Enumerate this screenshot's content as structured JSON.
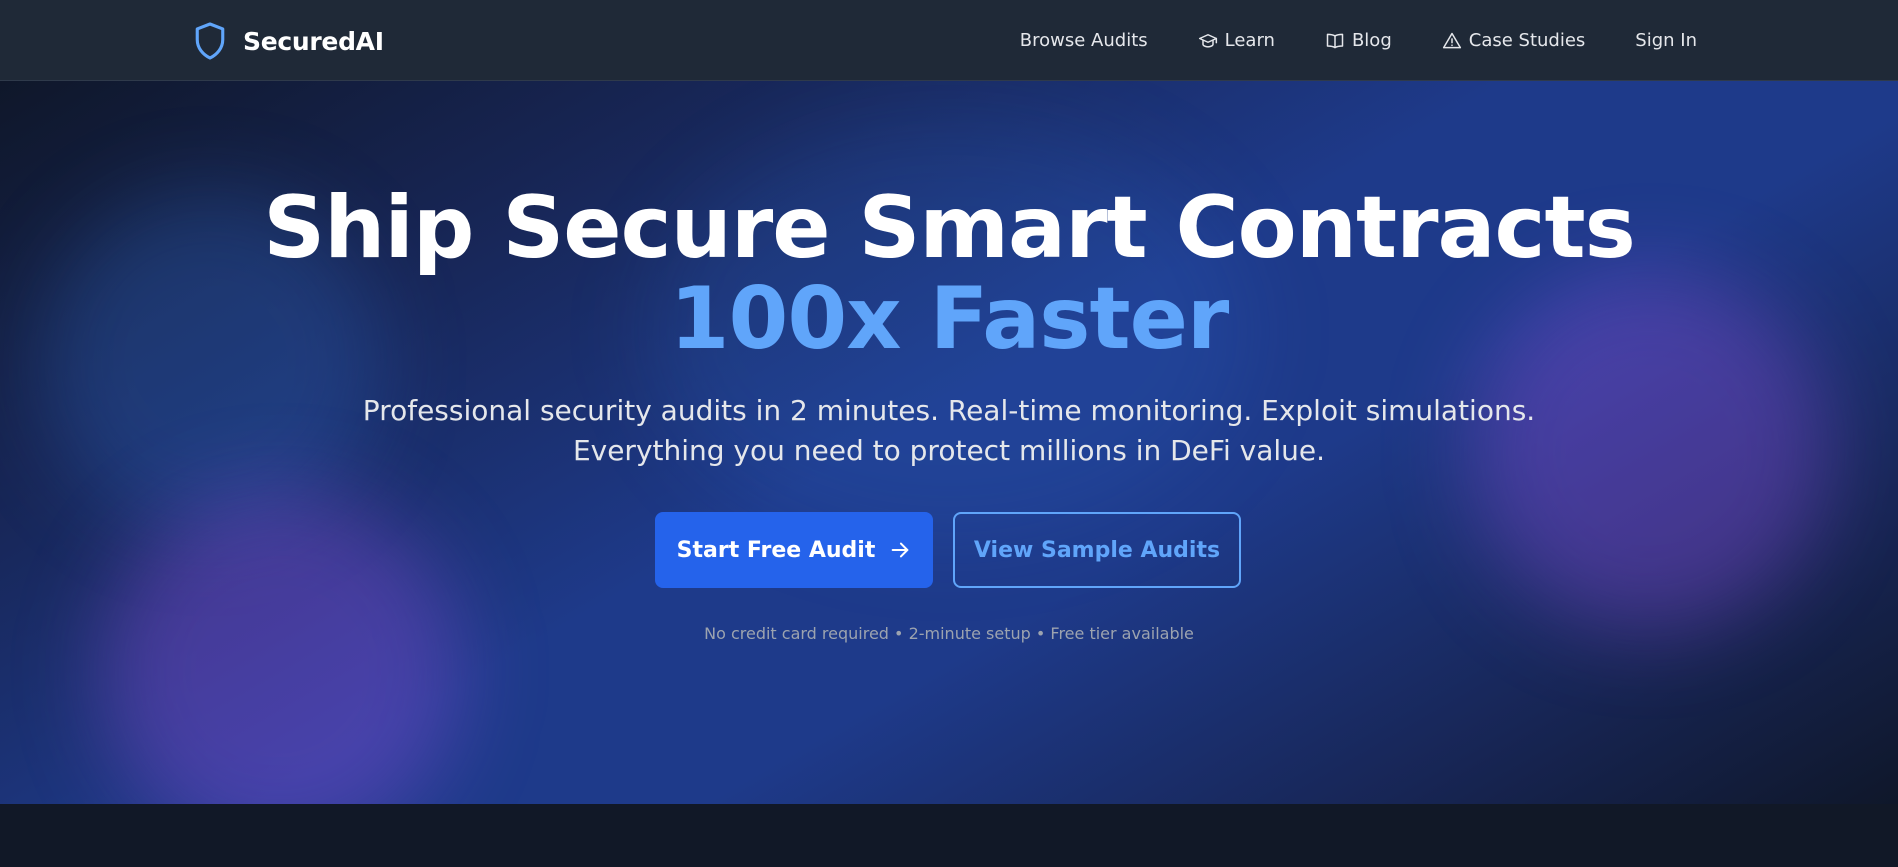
{
  "brand": {
    "name": "SecuredAI",
    "icon": "shield-icon",
    "accent_color": "#60a5fa"
  },
  "nav": {
    "items": [
      {
        "label": "Browse Audits",
        "icon": ""
      },
      {
        "label": "Learn",
        "icon": "graduation-cap-icon"
      },
      {
        "label": "Blog",
        "icon": "book-open-icon"
      },
      {
        "label": "Case Studies",
        "icon": "alert-triangle-icon"
      },
      {
        "label": "Sign In",
        "icon": ""
      }
    ]
  },
  "hero": {
    "headline": "Ship Secure Smart Contracts",
    "headline_accent": "100x Faster",
    "subtitle_line1": "Professional security audits in 2 minutes. Real-time monitoring. Exploit simulations.",
    "subtitle_line2": "Everything you need to protect millions in DeFi value.",
    "primary_cta": "Start Free Audit",
    "primary_cta_icon": "arrow-right-icon",
    "secondary_cta": "View Sample Audits",
    "fine_print": "No credit card required • 2-minute setup • Free tier available"
  },
  "colors": {
    "nav_background": "#1f2937",
    "primary_button": "#2563eb",
    "accent_text": "#60a5fa",
    "page_background": "#111827"
  }
}
